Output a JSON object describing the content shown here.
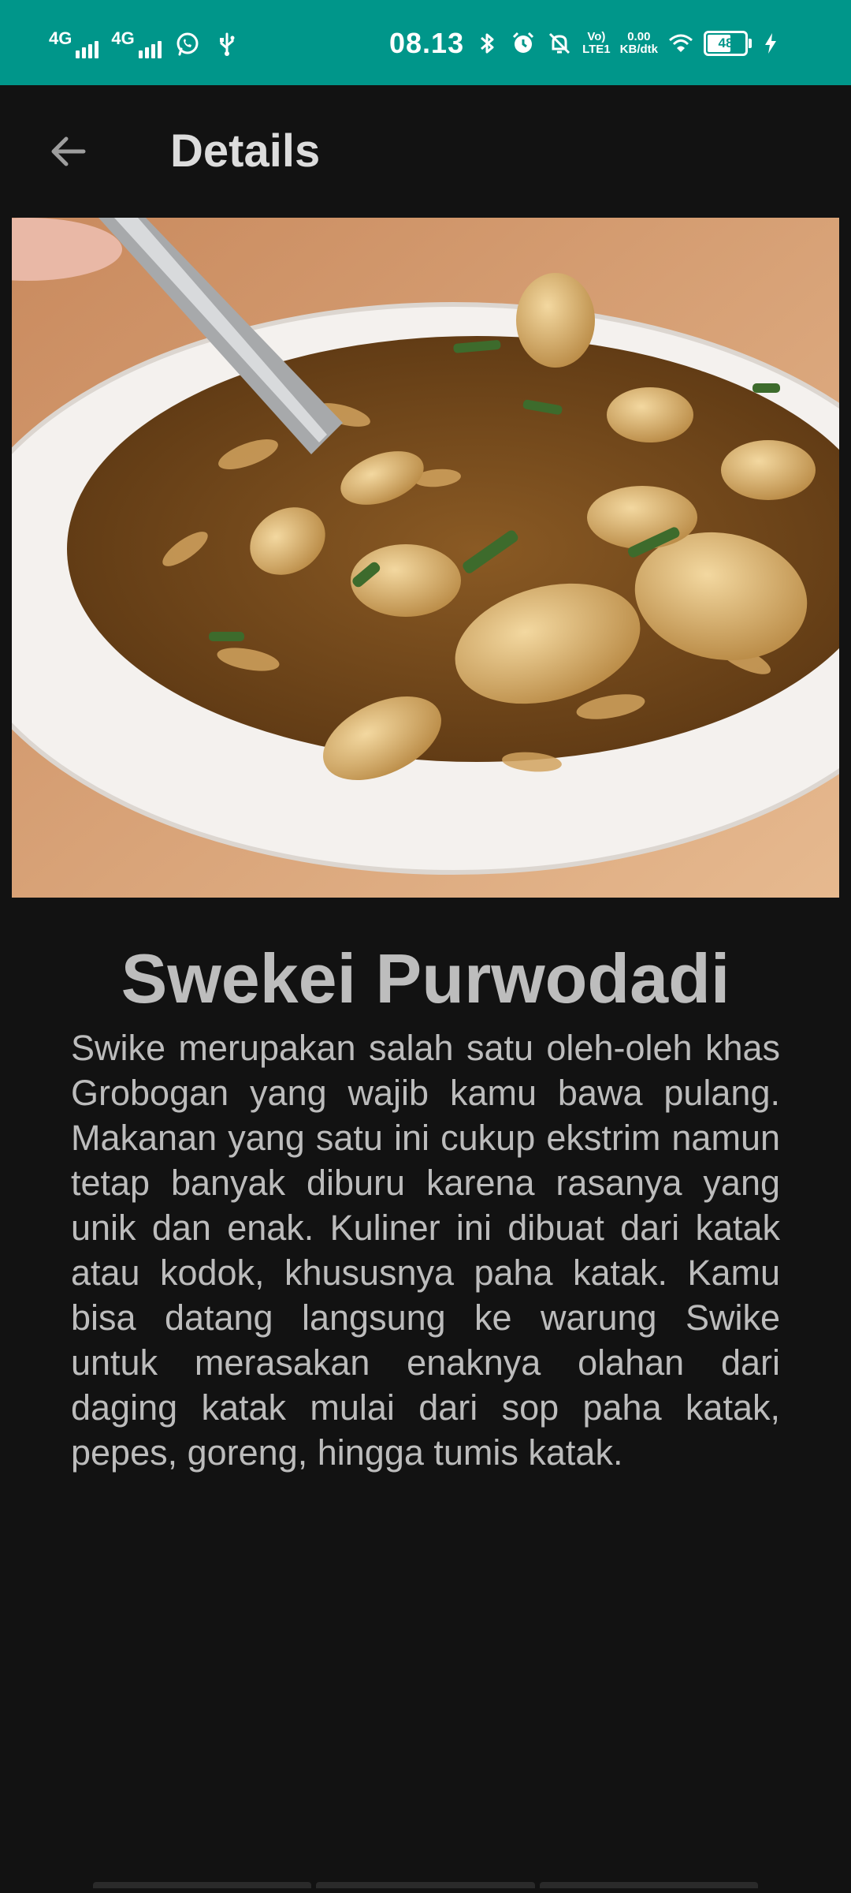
{
  "status_bar": {
    "network1": "4G",
    "network2": "4G",
    "time": "08.13",
    "volte_line1": "Vo)",
    "volte_line2": "LTE1",
    "speed_value": "0.00",
    "speed_unit": "KB/dtk",
    "battery": "48",
    "icons": [
      "signal-icon",
      "signal-icon",
      "whatsapp-icon",
      "usb-icon",
      "bluetooth-icon",
      "alarm-icon",
      "mute-icon",
      "wifi-icon",
      "battery-icon",
      "charging-icon"
    ]
  },
  "app_bar": {
    "back_icon": "arrow-back-icon",
    "title": "Details"
  },
  "detail": {
    "title": "Swekei Purwodadi",
    "description": "Swike merupakan salah satu oleh-oleh khas Grobogan yang wajib kamu bawa pulang. Makanan yang satu ini cukup ekstrim namun tetap banyak diburu karena rasanya yang unik dan enak. Kuliner ini dibuat dari katak atau kodok, khususnya paha katak. Kamu bisa datang langsung ke warung Swike untuk merasakan enaknya olahan dari daging katak mulai dari sop paha katak, pepes, goreng, hingga tumis katak."
  },
  "colors": {
    "status_bar": "#00968a",
    "background": "#121212",
    "title_text": "#bdbdbd",
    "body_text": "#bcbcbc"
  }
}
